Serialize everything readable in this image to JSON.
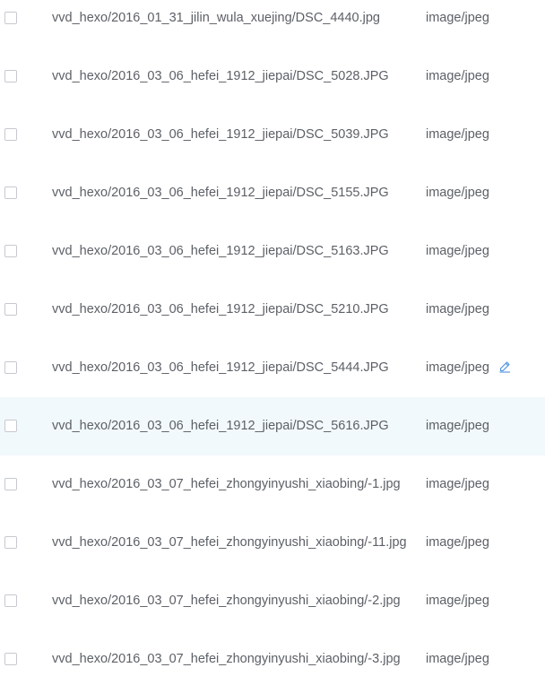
{
  "files": [
    {
      "name": "vvd_hexo/2016_01_31_jilin_wula_xuejing/DSC_4440.jpg",
      "type": "image/jpeg"
    },
    {
      "name": "vvd_hexo/2016_03_06_hefei_1912_jiepai/DSC_5028.JPG",
      "type": "image/jpeg"
    },
    {
      "name": "vvd_hexo/2016_03_06_hefei_1912_jiepai/DSC_5039.JPG",
      "type": "image/jpeg"
    },
    {
      "name": "vvd_hexo/2016_03_06_hefei_1912_jiepai/DSC_5155.JPG",
      "type": "image/jpeg"
    },
    {
      "name": "vvd_hexo/2016_03_06_hefei_1912_jiepai/DSC_5163.JPG",
      "type": "image/jpeg"
    },
    {
      "name": "vvd_hexo/2016_03_06_hefei_1912_jiepai/DSC_5210.JPG",
      "type": "image/jpeg"
    },
    {
      "name": "vvd_hexo/2016_03_06_hefei_1912_jiepai/DSC_5444.JPG",
      "type": "image/jpeg",
      "edit_icon": "pencil-edit-icon"
    },
    {
      "name": "vvd_hexo/2016_03_06_hefei_1912_jiepai/DSC_5616.JPG",
      "type": "image/jpeg",
      "highlighted": true
    },
    {
      "name": "vvd_hexo/2016_03_07_hefei_zhongyinyushi_xiaobing/-1.jpg",
      "type": "image/jpeg"
    },
    {
      "name": "vvd_hexo/2016_03_07_hefei_zhongyinyushi_xiaobing/-11.jpg",
      "type": "image/jpeg"
    },
    {
      "name": "vvd_hexo/2016_03_07_hefei_zhongyinyushi_xiaobing/-2.jpg",
      "type": "image/jpeg"
    },
    {
      "name": "vvd_hexo/2016_03_07_hefei_zhongyinyushi_xiaobing/-3.jpg",
      "type": "image/jpeg"
    }
  ],
  "colors": {
    "text": "#5c6066",
    "checkbox_border": "#c6c9cf",
    "row_highlight": "#f2f9fc",
    "edit_icon": "#4a8fe0"
  }
}
